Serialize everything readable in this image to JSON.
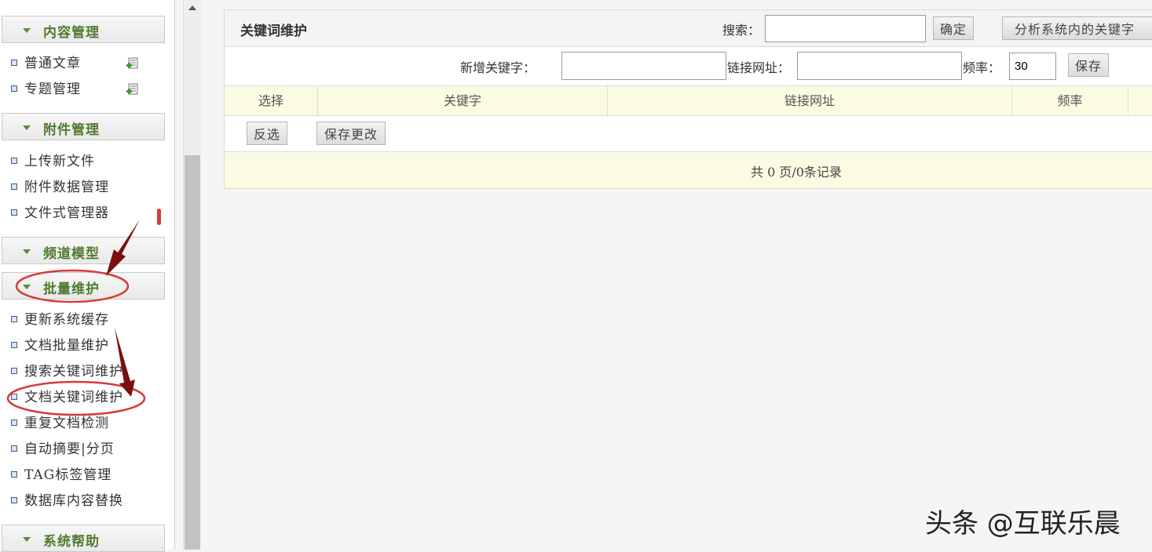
{
  "sidebar": {
    "sections": [
      {
        "label": "内容管理"
      },
      {
        "label": "附件管理"
      },
      {
        "label": "频道模型"
      },
      {
        "label": "批量维护"
      },
      {
        "label": "系统帮助"
      }
    ],
    "content_items": [
      {
        "label": "普通文章"
      },
      {
        "label": "专题管理"
      }
    ],
    "attachment_items": [
      {
        "label": "上传新文件"
      },
      {
        "label": "附件数据管理"
      },
      {
        "label": "文件式管理器"
      }
    ],
    "batch_items": [
      {
        "label": "更新系统缓存"
      },
      {
        "label": "文档批量维护"
      },
      {
        "label": "搜索关键词维护"
      },
      {
        "label": "文档关键词维护"
      },
      {
        "label": "重复文档检测"
      },
      {
        "label": "自动摘要|分页"
      },
      {
        "label": "TAG标签管理"
      },
      {
        "label": "数据库内容替换"
      }
    ]
  },
  "panel": {
    "title": "关键词维护",
    "search_label": "搜索：",
    "search_value": "",
    "confirm_label": "确定",
    "analyze_label": "分析系统内的关键字",
    "new_keyword_label": "新增关键字：",
    "new_keyword_value": "",
    "link_label": "链接网址：",
    "link_value": "",
    "rate_label": "频率：",
    "rate_value": "30",
    "save_label": "保存",
    "columns": [
      "选择",
      "关键字",
      "链接网址",
      "频率"
    ],
    "invert_label": "反选",
    "save_changes_label": "保存更改",
    "pagination": "共 0 页/0条记录"
  },
  "watermark": "头条 @互联乐晨",
  "colors": {
    "accent_green": "#4f7b2e",
    "header_row": "#fbfbe4",
    "annotation_red": "#d83a3a",
    "arrow_dark": "#7a0f0f"
  }
}
